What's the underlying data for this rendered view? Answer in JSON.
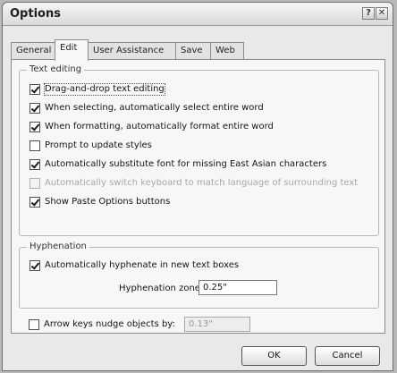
{
  "window": {
    "title": "Options"
  },
  "tabs": [
    {
      "label": "General"
    },
    {
      "label": "Edit"
    },
    {
      "label": "User Assistance"
    },
    {
      "label": "Save"
    },
    {
      "label": "Web"
    }
  ],
  "active_tab": "Edit",
  "text_editing": {
    "legend": "Text editing",
    "options": [
      {
        "label": "Drag-and-drop text editing",
        "checked": true,
        "enabled": true
      },
      {
        "label": "When selecting, automatically select entire word",
        "checked": true,
        "enabled": true
      },
      {
        "label": "When formatting, automatically format entire word",
        "checked": true,
        "enabled": true
      },
      {
        "label": "Prompt to update styles",
        "checked": false,
        "enabled": true
      },
      {
        "label": "Automatically substitute font for missing East Asian characters",
        "checked": true,
        "enabled": true
      },
      {
        "label": "Automatically switch keyboard to match language of surrounding text",
        "checked": false,
        "enabled": false
      },
      {
        "label": "Show Paste Options buttons",
        "checked": true,
        "enabled": true
      }
    ]
  },
  "hyphenation": {
    "legend": "Hyphenation",
    "auto_label": "Automatically hyphenate in new text boxes",
    "auto_checked": true,
    "zone_label": "Hyphenation zone:",
    "zone_value": "0.25\""
  },
  "nudge": {
    "label": "Arrow keys nudge objects by:",
    "checked": false,
    "value": "0.13\""
  },
  "buttons": {
    "ok": "OK",
    "cancel": "Cancel"
  }
}
